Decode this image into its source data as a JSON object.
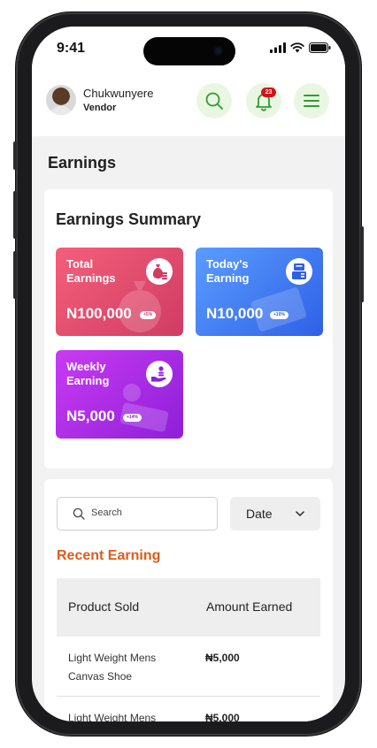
{
  "status_bar": {
    "time": "9:41"
  },
  "header": {
    "user_name": "Chukwunyere",
    "user_role": "Vendor",
    "notification_count": "23"
  },
  "page": {
    "title": "Earnings"
  },
  "summary": {
    "title": "Earnings Summary",
    "tiles": [
      {
        "label": "Total Earnings",
        "amount": "N100,000",
        "change": "+5%",
        "icon": "money-bag-icon",
        "color": "#e2506f"
      },
      {
        "label": "Today's Earning",
        "amount": "N10,000",
        "change": "+10%",
        "icon": "cash-register-icon",
        "color": "#3d76f0"
      },
      {
        "label": "Weekly Earning",
        "amount": "N5,000",
        "change": "+14%",
        "icon": "hand-coins-icon",
        "color": "#ae2de6"
      }
    ]
  },
  "filters": {
    "search_placeholder": "Search",
    "date_label": "Date"
  },
  "recent": {
    "title": "Recent Earning",
    "columns": [
      "Product Sold",
      "Amount Earned"
    ],
    "rows": [
      {
        "product": "Light Weight Mens Canvas Shoe",
        "amount": "₦5,000"
      },
      {
        "product": "Light Weight Mens",
        "amount": "₦5,000"
      }
    ]
  },
  "colors": {
    "accent_green": "#2e9e2e",
    "accent_orange": "#e05a1c",
    "badge_red": "#d0121b"
  }
}
